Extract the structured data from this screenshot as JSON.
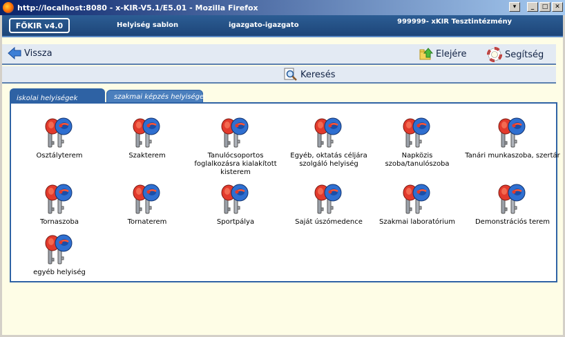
{
  "window": {
    "title": "http://localhost:8080 - x-KIR-V5.1/E5.01 - Mozilla Firefox",
    "btn_menu": "▾",
    "btn_min": "_",
    "btn_max": "□",
    "btn_close": "✕"
  },
  "header": {
    "logo": "FŐKIR v4.0",
    "template": "Helyiség sablon",
    "user": "igazgato-igazgato",
    "institution": "999999- xKIR Tesztintézmény"
  },
  "nav": {
    "back": "Vissza",
    "top": "Elejére",
    "help": "Segítség",
    "search": "Keresés"
  },
  "tabs": [
    {
      "label": "iskolai helyiségek",
      "active": true
    },
    {
      "label": "szakmai képzés helyiségei",
      "active": false
    }
  ],
  "rooms": [
    {
      "label": "Osztályterem"
    },
    {
      "label": "Szakterem"
    },
    {
      "label": "Tanulócsoportos foglalkozásra kialakított kisterem"
    },
    {
      "label": "Egyéb, oktatás céljára szolgáló helyiség"
    },
    {
      "label": "Napközis szoba/tanulószoba"
    },
    {
      "label": "Tanári munkaszoba, szertár"
    },
    {
      "label": "Tornaszoba"
    },
    {
      "label": "Tornaterem"
    },
    {
      "label": "Sportpálya"
    },
    {
      "label": "Saját úszómedence"
    },
    {
      "label": "Szakmai laboratórium"
    },
    {
      "label": "Demonstrációs terem"
    },
    {
      "label": "egyéb helyiség"
    }
  ],
  "icons": {
    "room": "keys-icon",
    "back": "back-arrow-icon",
    "top": "folder-up-icon",
    "help": "lifebuoy-icon",
    "search": "magnifier-icon",
    "browser": "firefox-icon"
  }
}
